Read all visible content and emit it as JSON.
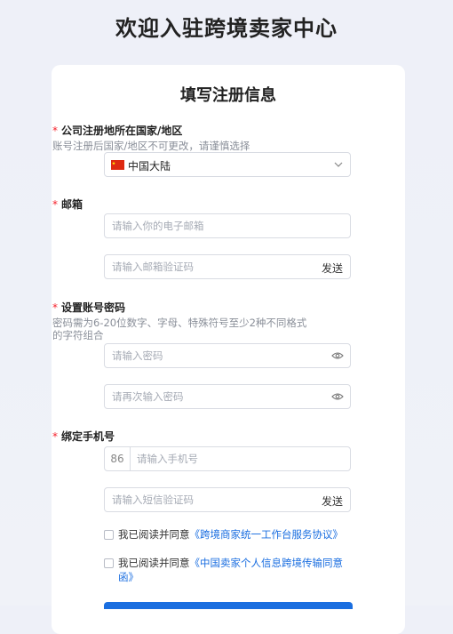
{
  "page": {
    "title": "欢迎入驻跨境卖家中心"
  },
  "form": {
    "title": "填写注册信息",
    "required_mark": "*",
    "country": {
      "label": "公司注册地所在国家/地区",
      "hint": "账号注册后国家/地区不可更改，请谨慎选择",
      "value": "中国大陆"
    },
    "email": {
      "label": "邮箱",
      "placeholder": "请输入你的电子邮箱",
      "code_placeholder": "请输入邮箱验证码",
      "send_label": "发送"
    },
    "password": {
      "label": "设置账号密码",
      "hint_line1": "密码需为6-20位数字、字母、特殊符号至少2种不同格式",
      "hint_line2": "的字符组合",
      "placeholder": "请输入密码",
      "confirm_placeholder": "请再次输入密码"
    },
    "phone": {
      "label": "绑定手机号",
      "prefix": "86",
      "placeholder": "请输入手机号",
      "code_placeholder": "请输入短信验证码",
      "send_label": "发送"
    },
    "agreements": [
      {
        "prefix": "我已阅读并同意",
        "link": "《跨境商家统一工作台服务协议》"
      },
      {
        "prefix": "我已阅读并同意",
        "link": "《中国卖家个人信息跨境传输同意函》"
      }
    ]
  },
  "colors": {
    "accent": "#1a6ee0",
    "required": "#f5222d",
    "border": "#d9dce3"
  },
  "icons": {
    "flag": "china-flag-icon",
    "dropdown": "chevron-down-icon",
    "eye": "eye-icon"
  }
}
